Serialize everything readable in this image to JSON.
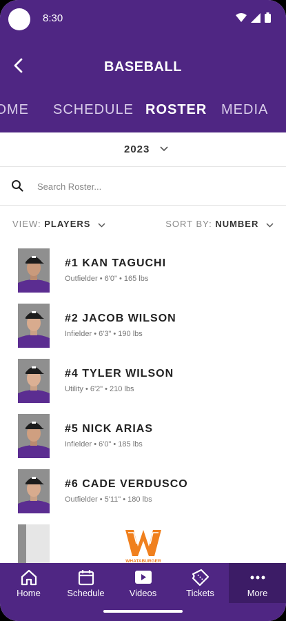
{
  "status_bar": {
    "time": "8:30"
  },
  "header": {
    "title": "BASEBALL"
  },
  "tabs": [
    {
      "label": "HOME"
    },
    {
      "label": "SCHEDULE"
    },
    {
      "label": "ROSTER"
    },
    {
      "label": "MEDIA"
    }
  ],
  "year_selector": {
    "value": "2023"
  },
  "search": {
    "placeholder": "Search Roster..."
  },
  "filters": {
    "view_prefix": "VIEW:",
    "view_value": "PLAYERS",
    "sort_prefix": "SORT BY:",
    "sort_value": "NUMBER"
  },
  "players": [
    {
      "name": "#1 KAN TAGUCHI",
      "meta": "Outfielder • 6'0\" • 165 lbs"
    },
    {
      "name": "#2 JACOB WILSON",
      "meta": "Infielder • 6'3\" • 190 lbs"
    },
    {
      "name": "#4 TYLER WILSON",
      "meta": "Utility • 6'2\" • 210 lbs"
    },
    {
      "name": "#5 NICK ARIAS",
      "meta": "Infielder • 6'0\" • 185 lbs"
    },
    {
      "name": "#6 CADE VERDUSCO",
      "meta": "Outfielder • 5'11\" • 180 lbs"
    }
  ],
  "sponsor": {
    "text": "WHATABURGER"
  },
  "bottom_nav": [
    {
      "label": "Home",
      "icon": "home-icon"
    },
    {
      "label": "Schedule",
      "icon": "calendar-icon"
    },
    {
      "label": "Videos",
      "icon": "play-icon"
    },
    {
      "label": "Tickets",
      "icon": "ticket-icon"
    },
    {
      "label": "More",
      "icon": "more-icon"
    }
  ],
  "colors": {
    "primary": "#4f2683",
    "primary_dark": "#3c1c66",
    "sponsor": "#f0801e"
  }
}
